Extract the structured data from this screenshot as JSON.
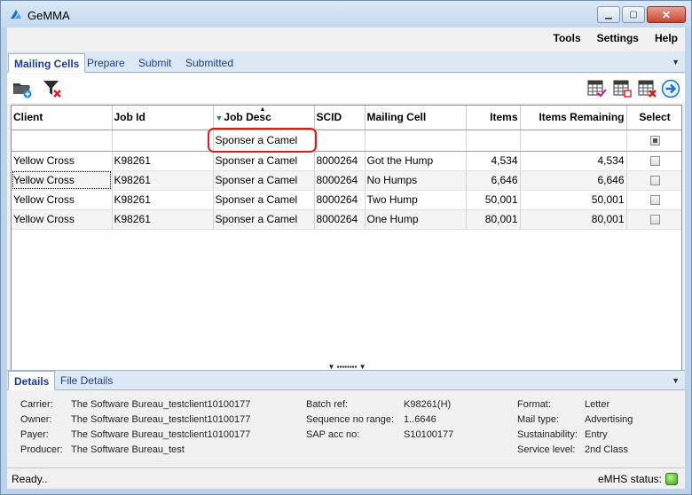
{
  "window": {
    "title": "GeMMA"
  },
  "menu": {
    "tools": "Tools",
    "settings": "Settings",
    "help": "Help"
  },
  "tabs": [
    {
      "label": "Mailing Cells"
    },
    {
      "label": "Prepare"
    },
    {
      "label": "Submit"
    },
    {
      "label": "Submitted"
    }
  ],
  "grid": {
    "columns": [
      "Client",
      "Job Id",
      "Job Desc",
      "SCID",
      "Mailing Cell",
      "Items",
      "Items Remaining",
      "Select"
    ],
    "filter": {
      "job_desc": "Sponser a Camel"
    },
    "rows": [
      {
        "client": "Yellow Cross",
        "job_id": "K98261",
        "job_desc": "Sponser a Camel",
        "scid": "8000264",
        "cell": "Got the Hump",
        "items": "4,534",
        "remaining": "4,534"
      },
      {
        "client": "Yellow Cross",
        "job_id": "K98261",
        "job_desc": "Sponser a Camel",
        "scid": "8000264",
        "cell": "No Humps",
        "items": "6,646",
        "remaining": "6,646"
      },
      {
        "client": "Yellow Cross",
        "job_id": "K98261",
        "job_desc": "Sponser a Camel",
        "scid": "8000264",
        "cell": "Two Hump",
        "items": "50,001",
        "remaining": "50,001"
      },
      {
        "client": "Yellow Cross",
        "job_id": "K98261",
        "job_desc": "Sponser a Camel",
        "scid": "8000264",
        "cell": "One Hump",
        "items": "80,001",
        "remaining": "80,001"
      }
    ]
  },
  "details_tabs": [
    {
      "label": "Details"
    },
    {
      "label": "File Details"
    }
  ],
  "details": {
    "carrier_label": "Carrier:",
    "carrier": "The Software Bureau_testclient10100177",
    "owner_label": "Owner:",
    "owner": "The Software Bureau_testclient10100177",
    "payer_label": "Payer:",
    "payer": "The Software Bureau_testclient10100177",
    "producer_label": "Producer:",
    "producer": "The Software Bureau_test",
    "batch_label": "Batch ref:",
    "batch": "K98261(H)",
    "seq_label": "Sequence no range:",
    "seq": "1..6646",
    "sap_label": "SAP acc no:",
    "sap": "S10100177",
    "format_label": "Format:",
    "format": "Letter",
    "mailtype_label": "Mail type:",
    "mailtype": "Advertising",
    "sustain_label": "Sustainability:",
    "sustain": "Entry",
    "service_label": "Service level:",
    "service": "2nd Class"
  },
  "status": {
    "text": "Ready..",
    "emhs_label": "eMHS status:"
  },
  "colors": {
    "accent": "#1a3e8a",
    "tab_bg": "#dde8f5",
    "highlight": "#d62020",
    "status_ok": "#3fa21c"
  }
}
